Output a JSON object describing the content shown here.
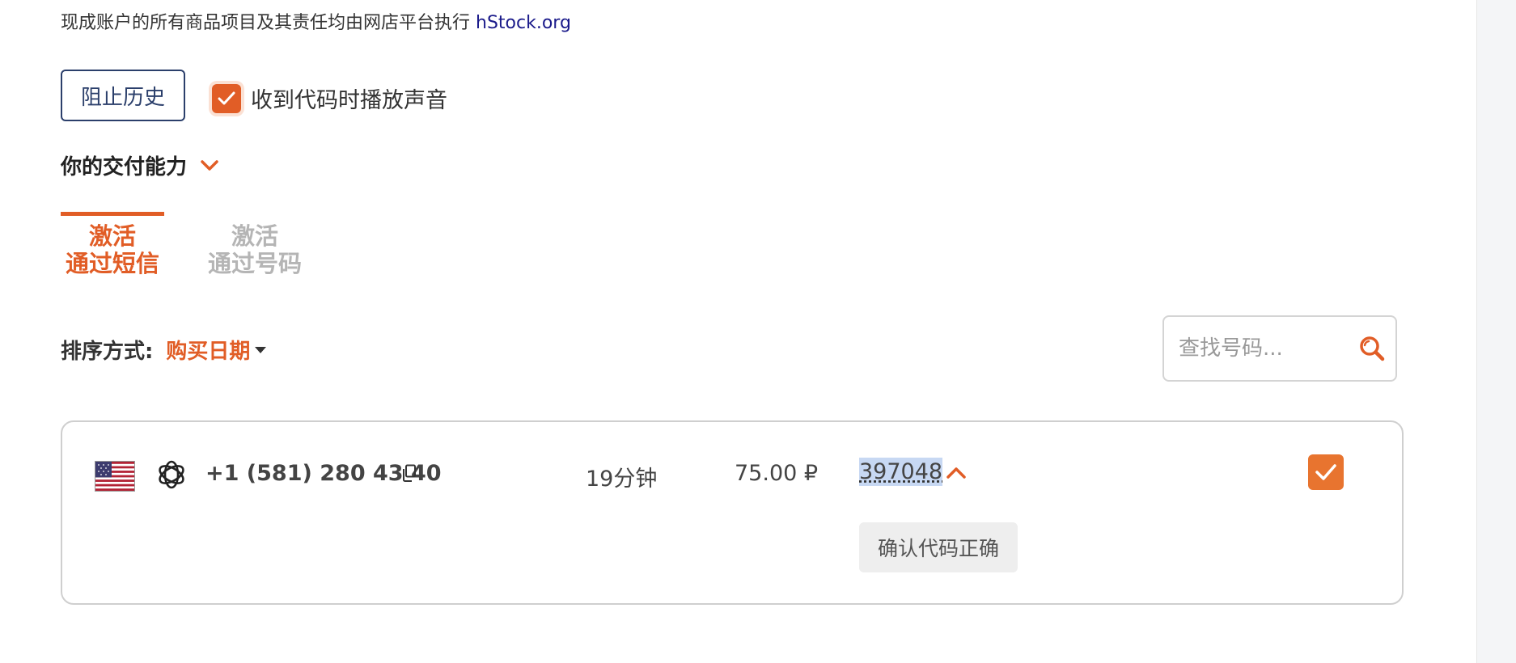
{
  "notice": {
    "text": "现成账户的所有商品项目及其责任均由网店平台执行",
    "link": "hStock.org"
  },
  "controls": {
    "block_history_label": "阻止历史",
    "sound_label": "收到代码时播放声音",
    "sound_checked": true
  },
  "capabilities": {
    "title": "你的交付能力"
  },
  "tabs": [
    {
      "line1": "激活",
      "line2": "通过短信",
      "active": true
    },
    {
      "line1": "激活",
      "line2": "通过号码",
      "active": false
    }
  ],
  "sort": {
    "label": "排序方式:",
    "value": "购买日期"
  },
  "search": {
    "placeholder": "查找号码..."
  },
  "order": {
    "country": "US",
    "service_icon": "openai-icon",
    "phone": "+1 (581) 280 43 40",
    "duration": "19分钟",
    "price": "75.00 ₽",
    "code": "397048",
    "confirm_label": "确认代码正确",
    "checked": true
  },
  "colors": {
    "accent": "#e15d26",
    "navy": "#2b3f6b",
    "link": "#1a1a8a",
    "code_highlight": "#c7d8f3"
  }
}
